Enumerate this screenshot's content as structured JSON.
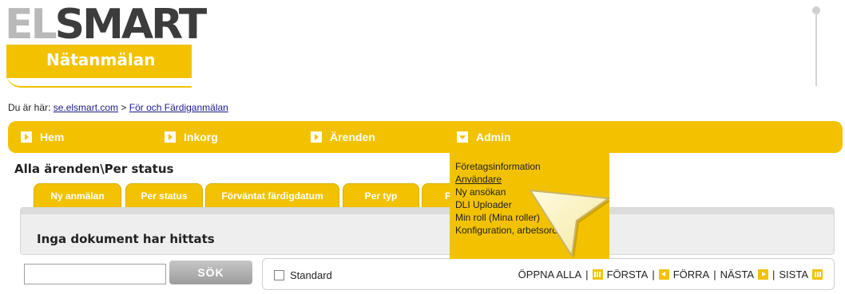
{
  "logo": {
    "el": "EL",
    "smart": "SMART",
    "subtitle": "Nätanmälan"
  },
  "breadcrumb": {
    "prefix": "Du är här:",
    "link1": "se.elsmart.com",
    "sep": ">",
    "link2": "För och Färdiganmälan"
  },
  "nav": {
    "items": [
      {
        "label": "Hem"
      },
      {
        "label": "Inkorg"
      },
      {
        "label": "Ärenden"
      },
      {
        "label": "Admin"
      }
    ]
  },
  "page": {
    "title": "Alla ärenden\\Per status"
  },
  "tabs": [
    {
      "label": "Ny anmälan"
    },
    {
      "label": "Per status"
    },
    {
      "label": "Förväntat färdigdatum"
    },
    {
      "label": "Per typ"
    },
    {
      "label": "P"
    }
  ],
  "panel": {
    "message": "Inga dokument har hittats"
  },
  "search": {
    "value": "",
    "button": "SÖK"
  },
  "filter": {
    "checkbox_label": "Standard",
    "checked": false
  },
  "pager": {
    "open_all": "ÖPPNA ALLA",
    "first": "FÖRSTA",
    "prev": "FÖRRA",
    "next": "NÄSTA",
    "last": "SISTA",
    "sep": "|"
  },
  "dropdown": {
    "items": [
      {
        "label": "Företagsinformation"
      },
      {
        "label": "Användare"
      },
      {
        "label": "Ny ansökan"
      },
      {
        "label": "DLI Uploader"
      },
      {
        "label": "Min roll (Mina roller)"
      },
      {
        "label": "Konfiguration, arbetsorder"
      }
    ]
  },
  "colors": {
    "accent": "#f2c200",
    "nav_text": "#ffffff",
    "panel": "#eeeeee"
  }
}
